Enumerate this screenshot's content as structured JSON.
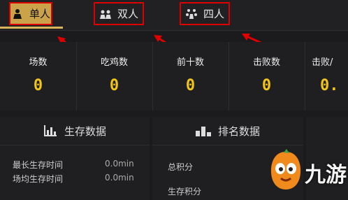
{
  "tabs": [
    {
      "label": "单人",
      "icon": "solo-person-icon",
      "active": true
    },
    {
      "label": "双人",
      "icon": "duo-people-icon",
      "active": false
    },
    {
      "label": "四人",
      "icon": "squad-people-icon",
      "active": false
    }
  ],
  "stats": [
    {
      "label": "场数",
      "value": "0"
    },
    {
      "label": "吃鸡数",
      "value": "0"
    },
    {
      "label": "前十数",
      "value": "0"
    },
    {
      "label": "击败数",
      "value": "0"
    },
    {
      "label": "击败/",
      "value": "0."
    }
  ],
  "survival": {
    "title": "生存数据",
    "rows": [
      {
        "label": "最长生存时间",
        "value": "0.0min"
      },
      {
        "label": "场均生存时间",
        "value": "0.0min"
      }
    ]
  },
  "ranking": {
    "title": "排名数据",
    "rows": [
      {
        "label": "总积分"
      },
      {
        "label": "生存积分"
      }
    ]
  },
  "watermark": {
    "text": "九游"
  },
  "colors": {
    "accent": "#f0c419",
    "tab_active": "#c9a24a",
    "highlight_box": "#dd0000",
    "arrow": "#e00000"
  }
}
